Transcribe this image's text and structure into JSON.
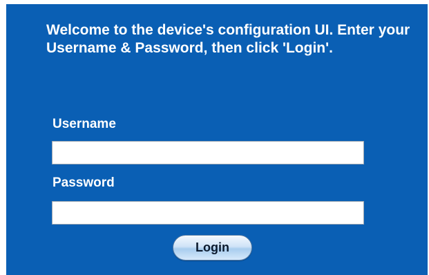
{
  "welcome_message": "Welcome to the device's configuration UI. Enter your Username & Password, then click 'Login'.",
  "form": {
    "username_label": "Username",
    "username_value": "",
    "password_label": "Password",
    "password_value": "",
    "login_label": "Login"
  },
  "colors": {
    "panel_background": "#0a5fb4",
    "text": "#ffffff"
  }
}
